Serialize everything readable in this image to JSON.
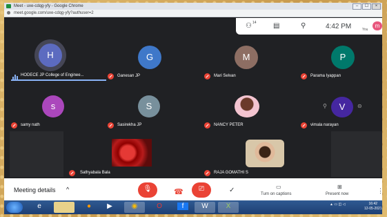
{
  "browser": {
    "title": "Meet - uxe-cdqg-yfy - Google Chrome",
    "url": "meet.google.com/uxe-cdqg-yfy?authuser=2",
    "buttons": [
      "–",
      "☐",
      "×"
    ]
  },
  "meet_topbar": {
    "people_count": "14",
    "time": "4:42 PM",
    "me_initial": "m",
    "me_label": "You"
  },
  "participants": [
    {
      "name": "HODECE JP College of Enginee...",
      "initial": "H",
      "color": "#5c6bc0",
      "speaking": true
    },
    {
      "name": "Ganesan JP",
      "initial": "G",
      "color": "#3f78c9",
      "muted": true
    },
    {
      "name": "Mari Selvan",
      "initial": "M",
      "color": "#8d6e63",
      "muted": true
    },
    {
      "name": "Parama Iyappan",
      "initial": "P",
      "color": "#00796b",
      "muted": true
    },
    {
      "name": "samy nath",
      "initial": "s",
      "color": "#ab47bc",
      "muted": true
    },
    {
      "name": "Sasirekha JP",
      "initial": "S",
      "color": "#78909c",
      "muted": true
    },
    {
      "name": "NANCY PETER",
      "initial": "",
      "color": "#f3c4d0",
      "muted": true,
      "photo": true
    },
    {
      "name": "vimala narayan",
      "initial": "V",
      "color": "#4527a0",
      "muted": true
    },
    {
      "name": "Sathyabala Bala",
      "initial": "",
      "color": "#b71c1c",
      "muted": true,
      "photo": true
    },
    {
      "name": "RAJA GOMATHI S",
      "initial": "",
      "color": "#e6d6b8",
      "muted": true,
      "photo": true
    }
  ],
  "toolbar": {
    "meeting_details": "Meeting details",
    "turn_on_captions": "Turn on captions",
    "present_now": "Present now"
  },
  "taskbar": {
    "clock_time": "16:42",
    "clock_date": "12-05-2021"
  }
}
